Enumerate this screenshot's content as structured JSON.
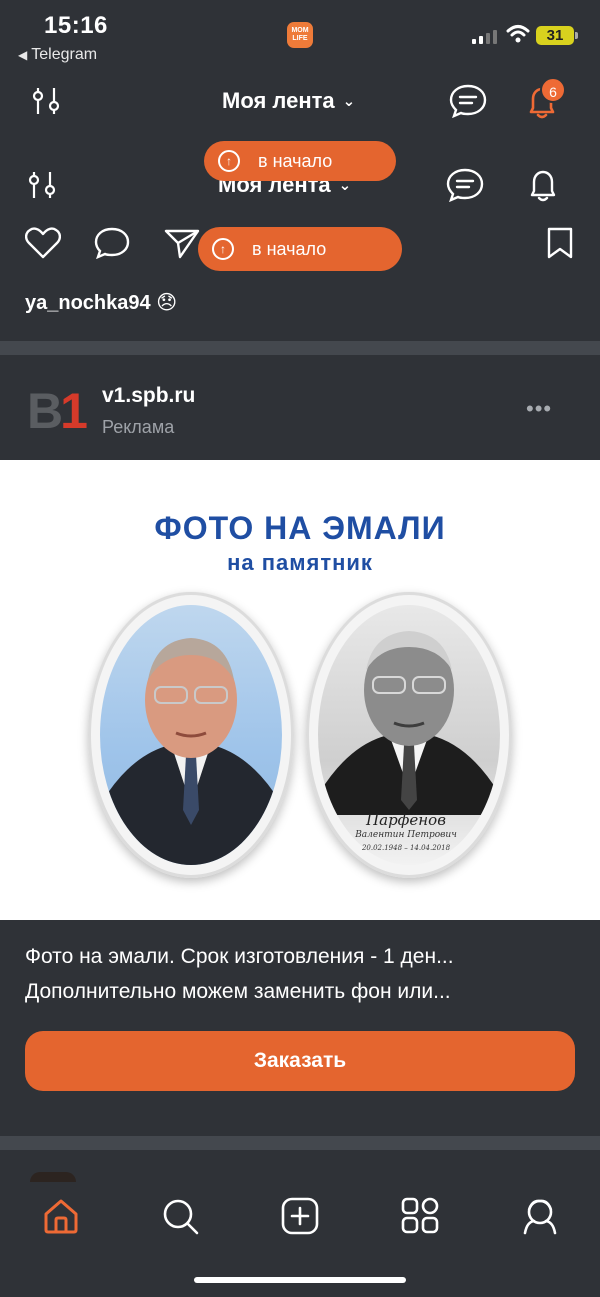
{
  "status_bar": {
    "time": "15:16",
    "back_app": "Telegram",
    "app_badge_text": "MOM LIFE",
    "battery": "31"
  },
  "header": {
    "title": "Моя лента",
    "notifications_count": "6"
  },
  "scroll_to_top": {
    "label": "в начало"
  },
  "post_prev": {
    "username": "ya_nochka94",
    "emoji": "😞"
  },
  "ad": {
    "logo_text_b": "B",
    "logo_text_1": "1",
    "domain": "v1.spb.ru",
    "label": "Реклама",
    "banner_title": "ФОТО НА ЭМАЛИ",
    "banner_subtitle": "на памятник",
    "plaque_name": "Парфёнов",
    "plaque_patronymic": "Валентин Петрович",
    "plaque_dates": "20.02.1948 – 14.04.2018",
    "description_line1": "Фото на эмали. Срок изготовления - 1 ден...",
    "description_line2": "Дополнительно можем заменить фон или...",
    "cta_label": "Заказать"
  },
  "colors": {
    "accent": "#e4652f",
    "background": "#2f3237",
    "banner_blue": "#1f4ea3"
  },
  "icons": {
    "filters": "sliders-icon",
    "chat": "chat-icon",
    "notifications": "bell-icon",
    "like": "heart-icon",
    "comment": "comment-icon",
    "share": "send-icon",
    "bookmark": "bookmark-icon",
    "nav": [
      "home-icon",
      "search-icon",
      "add-icon",
      "apps-icon",
      "profile-icon"
    ]
  }
}
